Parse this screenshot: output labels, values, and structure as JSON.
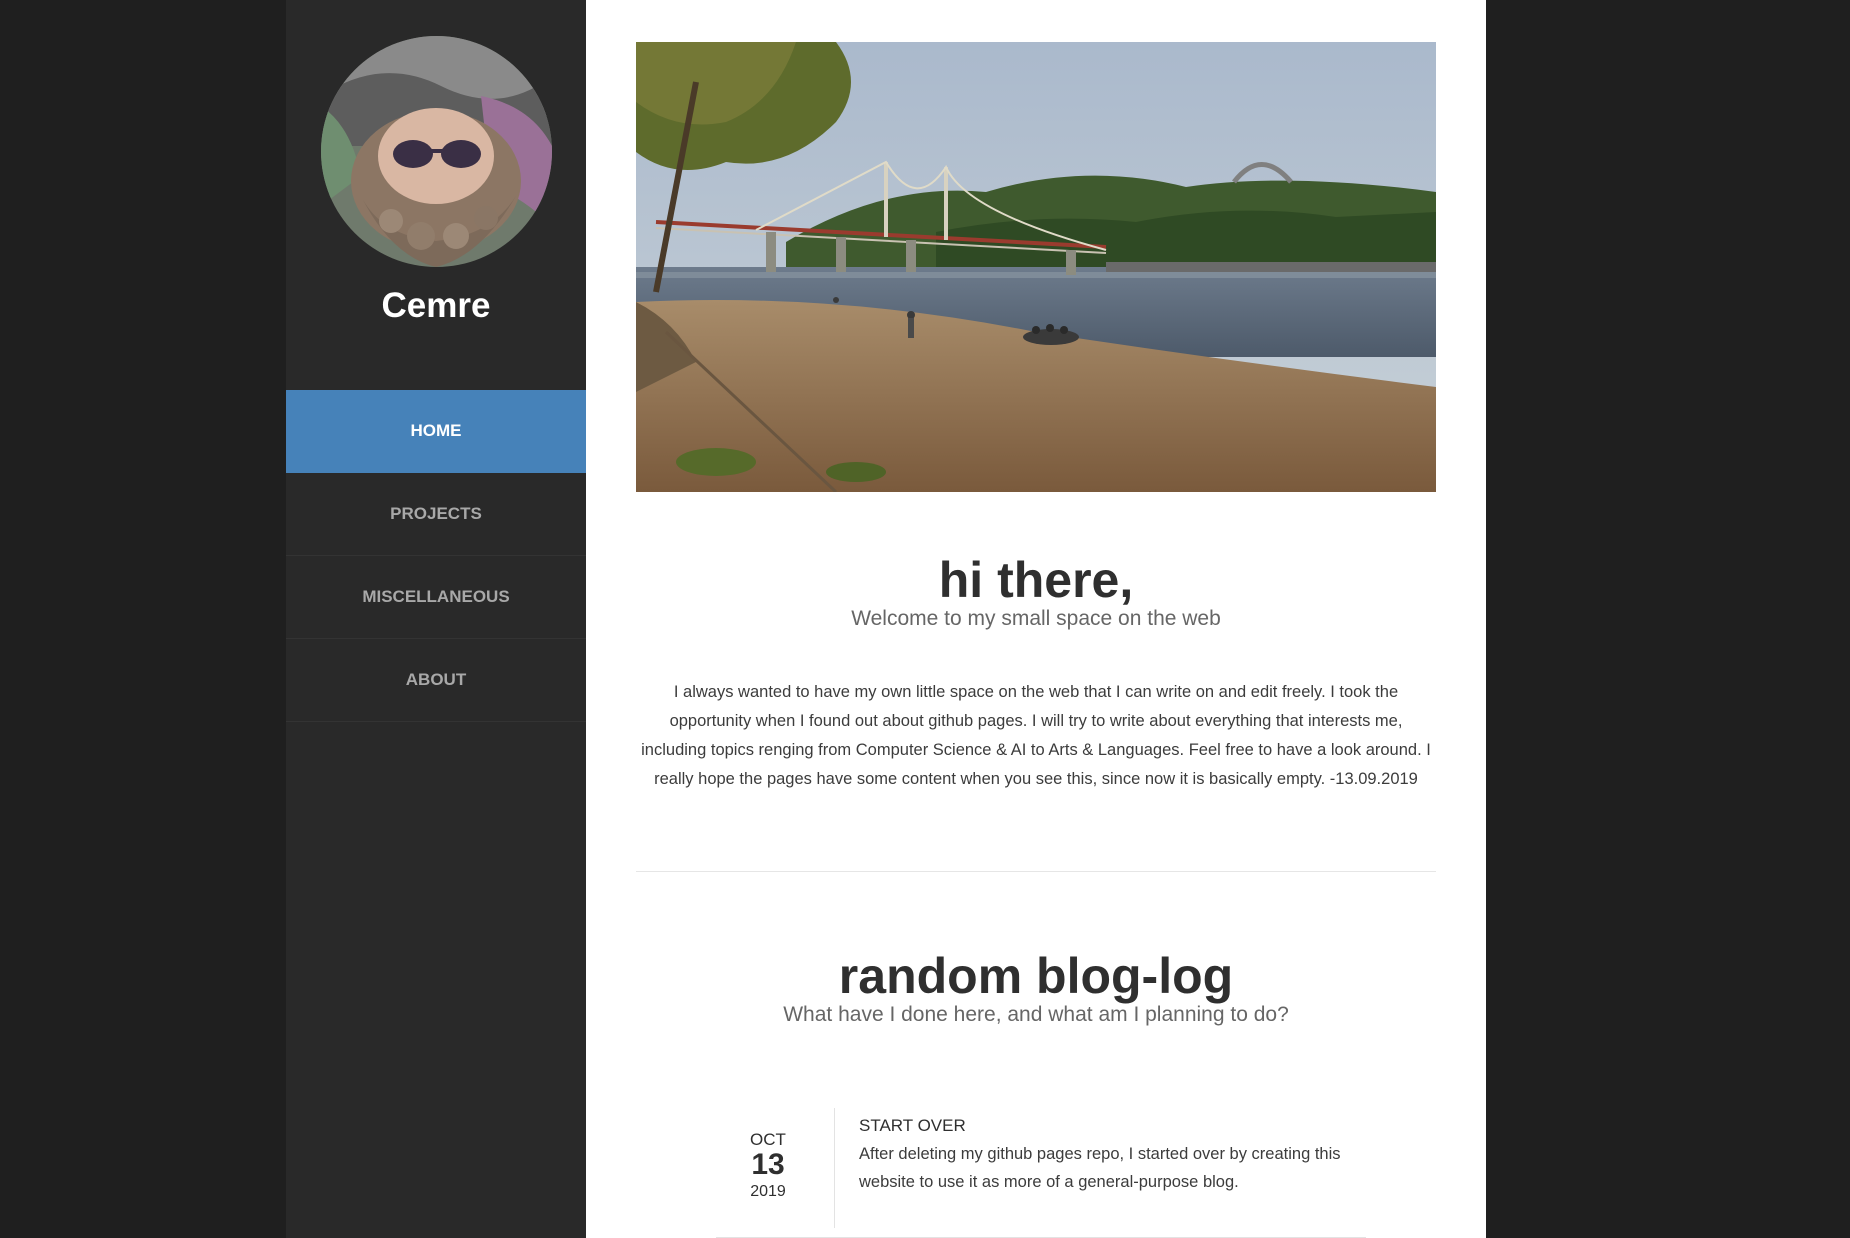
{
  "site": {
    "name": "Cemre",
    "avatar_alt": "Cemre"
  },
  "nav": {
    "items": [
      {
        "label": "HOME",
        "active": true
      },
      {
        "label": "PROJECTS",
        "active": false
      },
      {
        "label": "MISCELLANEOUS",
        "active": false
      },
      {
        "label": "ABOUT",
        "active": false
      }
    ]
  },
  "intro": {
    "title": "hi there,",
    "subtitle": "Welcome to my small space on the web",
    "body": "I always wanted to have my own little space on the web that I can write on and edit freely. I took the opportunity when I found out about github pages. I will try to write about everything that interests me, including topics renging from Computer Science & AI to Arts & Languages. Feel free to have a look around. I really hope the pages have some content when you see this, since now it is basically empty. -13.09.2019"
  },
  "blog": {
    "title": "random blog-log",
    "subtitle": "What have I done here, and what am I planning to do?",
    "posts": [
      {
        "month": "OCT",
        "day": "13",
        "year": "2019",
        "title": "START OVER",
        "excerpt": "After deleting my github pages repo, I started over by creating this website to use it as more of a general-purpose blog."
      }
    ]
  },
  "colors": {
    "sidebar_bg": "#292929",
    "page_bg": "#1f1f1f",
    "accent": "#4682b9"
  }
}
